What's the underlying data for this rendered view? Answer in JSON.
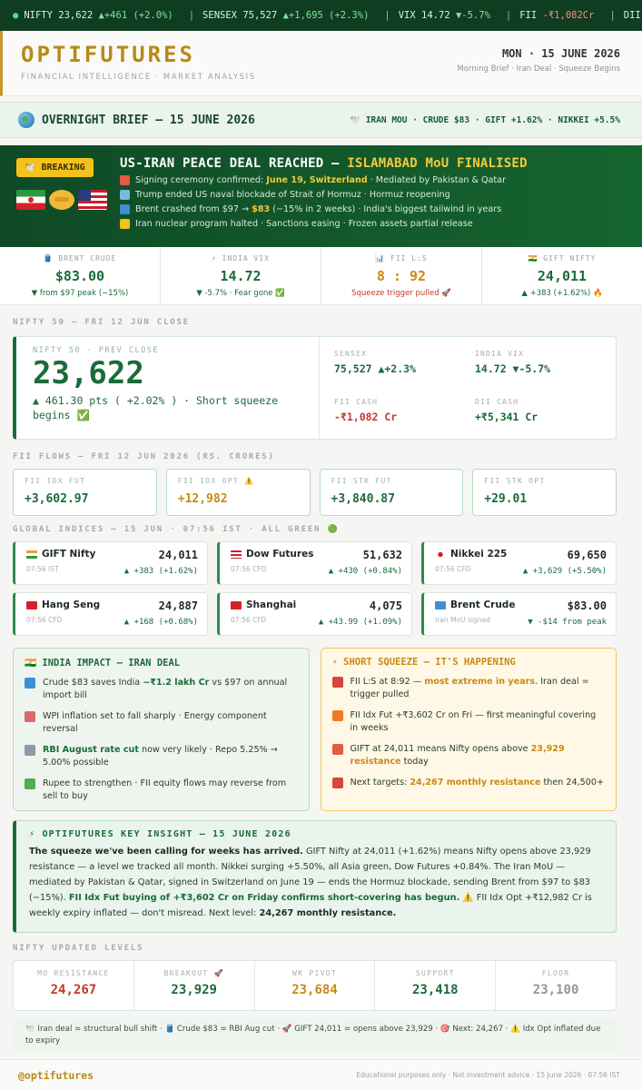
{
  "ticker": [
    {
      "label": "NIFTY",
      "value": "23,622",
      "change": "▲+461 (+2.0%)",
      "color": "#7ee39b"
    },
    {
      "label": "SENSEX",
      "value": "75,527",
      "change": "▲+1,695 (+2.3%)",
      "color": "#7ee39b"
    },
    {
      "label": "VIX",
      "value": "14.72",
      "change": "▼-5.7%",
      "color": "#7ee39b"
    },
    {
      "label": "FII",
      "value": "-₹1,082Cr",
      "change": "",
      "color": "#ff8a80"
    },
    {
      "label": "DII",
      "value": "",
      "change": "",
      "color": "#d9f2df"
    }
  ],
  "header": {
    "brand": "OPTIFUTURES",
    "tagline": "FINANCIAL INTELLIGENCE · MARKET ANALYSIS",
    "date": "MON · 15 JUNE 2026",
    "note": "Morning Brief · Iran Deal · Squeeze Begins"
  },
  "brief": {
    "title": "OVERNIGHT BRIEF — 15 JUNE 2026",
    "right": "🕊️ IRAN MOU · CRUDE $83 · GIFT +1.62% · NIKKEI +5.5%"
  },
  "breaking": {
    "badge": "🕊️ BREAKING",
    "title_main": "US-IRAN PEACE DEAL REACHED — ",
    "title_highlight": "ISLAMABAD MoU FINALISED",
    "lines": [
      {
        "pre": "Signing ceremony confirmed: ",
        "hl": "June 19, Switzerland",
        "post": " · Mediated by Pakistan & Qatar",
        "icon": "calendar-icon",
        "color": "#e25b45"
      },
      {
        "pre": "Trump ended US naval blockade of Strait of Hormuz · Hormuz reopening",
        "hl": "",
        "post": "",
        "icon": "anchor-icon",
        "color": "#7ab8e0"
      },
      {
        "pre": "Brent crashed from $97 → ",
        "hl": "$83",
        "post": " (−15% in 2 weeks) · India's biggest tailwind in years",
        "icon": "barrel-icon",
        "color": "#3d8fd6"
      },
      {
        "pre": "Iran nuclear program halted · Sanctions easing · Frozen assets partial release",
        "hl": "",
        "post": "",
        "icon": "radiation-icon",
        "color": "#f2c21b"
      }
    ]
  },
  "stats": [
    {
      "label": "🛢️ BRENT CRUDE",
      "value": "$83.00",
      "sub": "▼ from $97 peak (−15%)",
      "valcolor": "green",
      "subcolor": "green"
    },
    {
      "label": "⚡ INDIA VIX",
      "value": "14.72",
      "sub": "▼ -5.7% · Fear gone ✅",
      "valcolor": "green",
      "subcolor": "green"
    },
    {
      "label": "📊 FII L:S",
      "value": "8 : 92",
      "sub": "Squeeze trigger pulled 🚀",
      "valcolor": "gold",
      "subcolor": "red"
    },
    {
      "label": "🇮🇳 GIFT NIFTY",
      "value": "24,011",
      "sub": "▲ +383 (+1.62%) 🔥",
      "valcolor": "green",
      "subcolor": "green"
    }
  ],
  "nifty_section_label": "NIFTY 50 — FRI 12 JUN CLOSE",
  "nifty": {
    "label": "NIFTY 50 · PREV CLOSE",
    "value": "23,622",
    "change": "▲ 461.30 pts  ( +2.02% ) · Short squeeze begins ✅",
    "side": [
      {
        "label": "SENSEX",
        "value": "75,527 ▲+2.3%",
        "color": "green"
      },
      {
        "label": "INDIA VIX",
        "value": "14.72 ▼-5.7%",
        "color": "green"
      },
      {
        "label": "FII CASH",
        "value": "-₹1,082 Cr",
        "color": "red"
      },
      {
        "label": "DII CASH",
        "value": "+₹5,341 Cr",
        "color": "green"
      }
    ]
  },
  "fii_section_label": "FII FLOWS — FRI 12 JUN 2026 (RS. CRORES)",
  "fii": [
    {
      "label": "FII IDX FUT",
      "value": "+3,602.97",
      "color": "green"
    },
    {
      "label": "FII IDX OPT ⚠️",
      "value": "+12,982",
      "color": "gold"
    },
    {
      "label": "FII STK FUT",
      "value": "+3,840.87",
      "color": "green"
    },
    {
      "label": "FII STK OPT",
      "value": "+29.01",
      "color": "green"
    }
  ],
  "global_section_label": "GLOBAL INDICES — 15 JUN · 07:56 IST · ALL GREEN 🟢",
  "indices": [
    {
      "name": "GIFT Nifty",
      "time": "07:56 IST",
      "value": "24,011",
      "change": "▲ +383 (+1.62%)",
      "flag": "india"
    },
    {
      "name": "Dow Futures",
      "time": "07:56 CFD",
      "value": "51,632",
      "change": "▲ +430 (+0.84%)",
      "flag": "us"
    },
    {
      "name": "Nikkei 225",
      "time": "07:56 CFD",
      "value": "69,650",
      "change": "▲ +3,629 (+5.50%)",
      "flag": "japan"
    },
    {
      "name": "Hang Seng",
      "time": "07:56 CFD",
      "value": "24,887",
      "change": "▲ +168 (+0.68%)",
      "flag": "hk"
    },
    {
      "name": "Shanghai",
      "time": "07:56 CFD",
      "value": "4,075",
      "change": "▲ +43.99 (+1.09%)",
      "flag": "china"
    },
    {
      "name": "Brent Crude",
      "time": "Iran MoU signed",
      "value": "$83.00",
      "change": "▼ -$14 from peak",
      "flag": "barrel"
    }
  ],
  "impact": {
    "title": "🇮🇳 INDIA IMPACT — IRAN DEAL",
    "items": [
      {
        "pre": "Crude $83 saves India ",
        "hl": "~₹1.2 lakh Cr",
        "post": " vs $97 on annual import bill",
        "icon": "barrel-icon",
        "color": "#3d8fd6"
      },
      {
        "pre": "WPI inflation set to fall sharply · Energy component reversal",
        "hl": "",
        "post": "",
        "icon": "chart-down-icon",
        "color": "#d96b6b"
      },
      {
        "pre": "",
        "hl": "RBI August rate cut",
        "post": " now very likely · Repo 5.25% → 5.00% possible",
        "icon": "bank-icon",
        "color": "#8a9aa6"
      },
      {
        "pre": "Rupee to strengthen · FII equity flows may reverse from sell to buy",
        "hl": "",
        "post": "",
        "icon": "cash-icon",
        "color": "#4fae56"
      }
    ]
  },
  "squeeze": {
    "title": "⚡ SHORT SQUEEZE — IT'S HAPPENING",
    "items": [
      {
        "pre": "FII L:S at 8:92 — ",
        "hl": "most extreme in years",
        "post": ". Iran deal = trigger pulled",
        "icon": "alarm-icon",
        "color": "#d8453a"
      },
      {
        "pre": "FII Idx Fut +₹3,602 Cr on Fri — first meaningful covering in weeks",
        "hl": "",
        "post": "",
        "icon": "fire-icon",
        "color": "#f07a22"
      },
      {
        "pre": "GIFT at 24,011 means Nifty opens above ",
        "hl": "23,929 resistance",
        "post": " today",
        "icon": "calendar-icon",
        "color": "#e25b45"
      },
      {
        "pre": "Next targets: ",
        "hl": "24,267 monthly resistance",
        "post": " then 24,500+",
        "icon": "target-icon",
        "color": "#d8453a"
      }
    ]
  },
  "insight": {
    "title": "⚡ OPTIFUTURES KEY INSIGHT — 15 JUNE 2026",
    "p1": "The squeeze we've been calling for weeks has arrived.",
    "p2": " GIFT Nifty at 24,011 (+1.62%) means Nifty opens above 23,929 resistance — a level we tracked all month. Nikkei surging +5.50%, all Asia green, Dow Futures +0.84%. The Iran MoU — mediated by Pakistan & Qatar, signed in Switzerland on June 19 — ends the Hormuz blockade, sending Brent from $97 to $83 (−15%). ",
    "p3": "FII Idx Fut buying of +₹3,602 Cr on Friday confirms short-covering has begun.",
    "p4": " ⚠️ FII Idx Opt +₹12,982 Cr is weekly expiry inflated — don't misread. Next level: ",
    "p5": "24,267 monthly resistance."
  },
  "levels_section_label": "NIFTY UPDATED LEVELS",
  "levels": [
    {
      "label": "MO RESISTANCE",
      "value": "24,267",
      "color": "#c0392b"
    },
    {
      "label": "BREAKOUT 🚀",
      "value": "23,929",
      "color": "#1b6b3a"
    },
    {
      "label": "WK PIVOT",
      "value": "23,684",
      "color": "#c88a14"
    },
    {
      "label": "SUPPORT",
      "value": "23,418",
      "color": "#1b6b3a"
    },
    {
      "label": "FLOOR",
      "value": "23,100",
      "color": "#8f9892"
    }
  ],
  "summary": "🕊️ Iran deal = structural bull shift · 🛢️ Crude $83 = RBI Aug cut · 🚀 GIFT 24,011 = opens above 23,929 · 🎯 Next: 24,267 · ⚠️ Idx Opt inflated due to expiry",
  "footer": {
    "handle": "@optifutures",
    "note": "Educational purposes only · Not investment advice · 15 June 2026 · 07:56 IST"
  }
}
